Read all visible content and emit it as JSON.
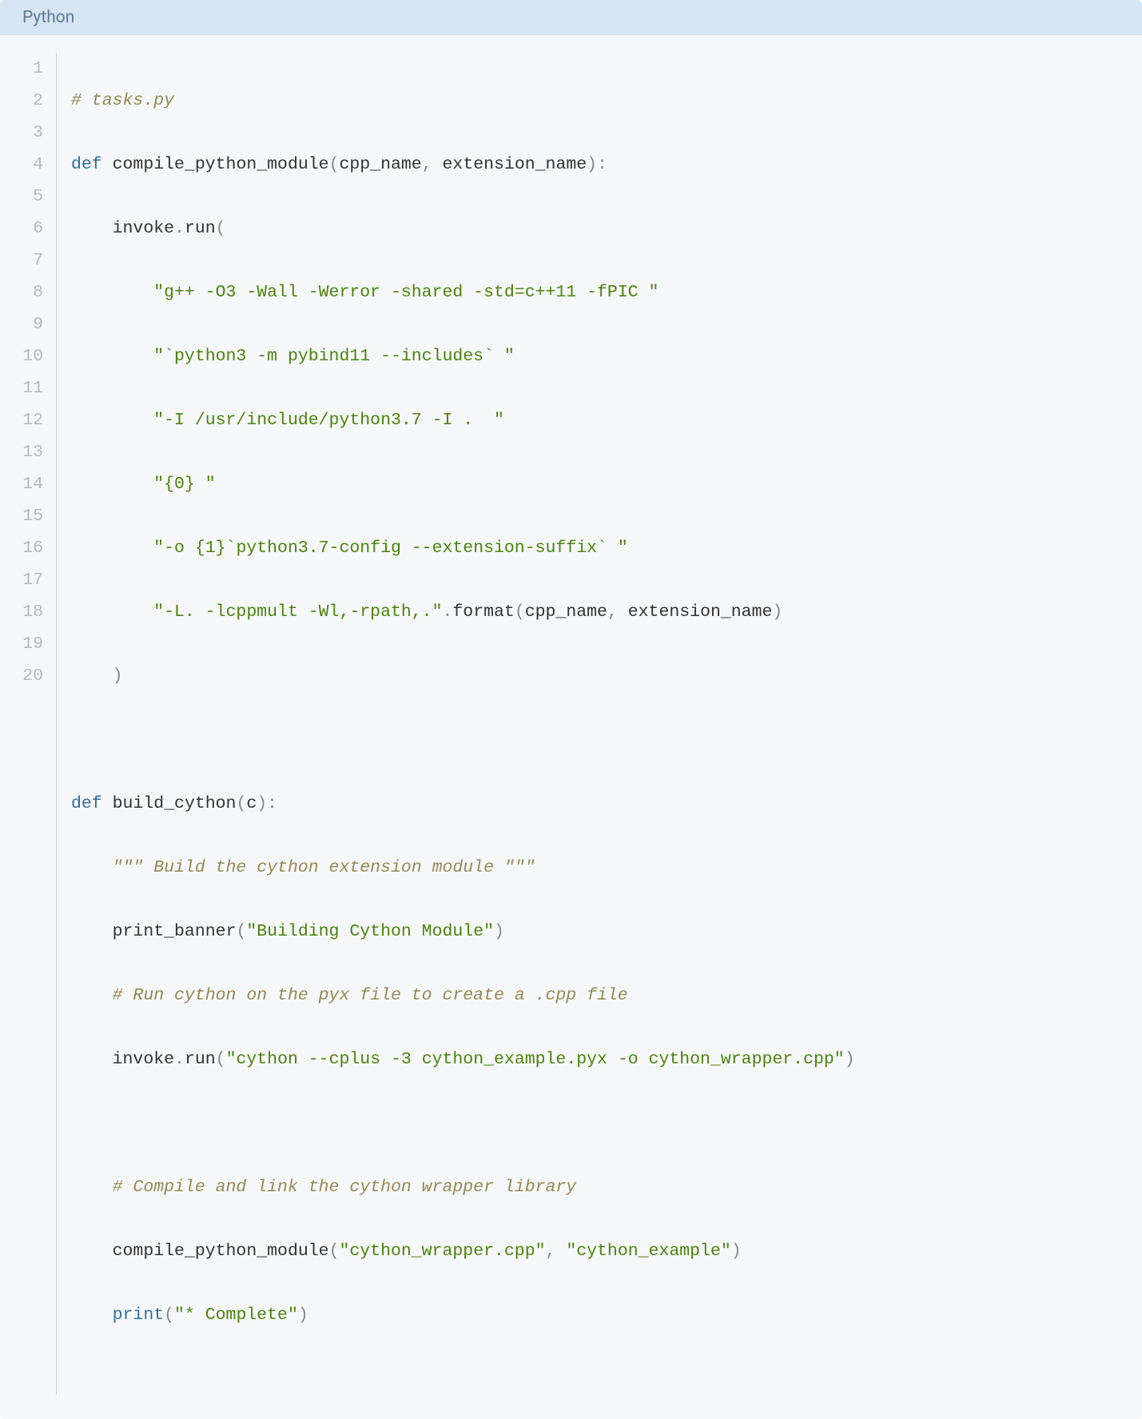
{
  "header": {
    "language_label": "Python"
  },
  "code": {
    "line_count": 20,
    "lines": {
      "l1_comment": "# tasks.py",
      "l2_def": "def",
      "l2_fn": "compile_python_module",
      "l2_p_cpp": "cpp_name",
      "l2_p_ext": "extension_name",
      "l3_invoke": "invoke",
      "l3_run": "run",
      "l4_str": "\"g++ -O3 -Wall -Werror -shared -std=c++11 -fPIC \"",
      "l5_str": "\"`python3 -m pybind11 --includes` \"",
      "l6_str": "\"-I /usr/include/python3.7 -I .  \"",
      "l7_str_open": "\"",
      "l7_str_brace": "{0}",
      "l7_str_close": " \"",
      "l8_str_a": "\"-o ",
      "l8_str_brace": "{1}",
      "l8_str_b": "`python3.7-config --extension-suffix` \"",
      "l9_str": "\"-L. -lcppmult -Wl,-rpath,.\"",
      "l9_format": "format",
      "l9_arg1": "cpp_name",
      "l9_arg2": "extension_name",
      "l12_def": "def",
      "l12_fn": "build_cython",
      "l12_p": "c",
      "l13_doc": "\"\"\" Build the cython extension module \"\"\"",
      "l14_fn": "print_banner",
      "l14_str": "\"Building Cython Module\"",
      "l15_comment": "# Run cython on the pyx file to create a .cpp file",
      "l16_invoke": "invoke",
      "l16_run": "run",
      "l16_str": "\"cython --cplus -3 cython_example.pyx -o cython_wrapper.cpp\"",
      "l18_comment": "# Compile and link the cython wrapper library",
      "l19_fn": "compile_python_module",
      "l19_arg1": "\"cython_wrapper.cpp\"",
      "l19_arg2": "\"cython_example\"",
      "l20_print": "print",
      "l20_str": "\"* Complete\""
    }
  }
}
